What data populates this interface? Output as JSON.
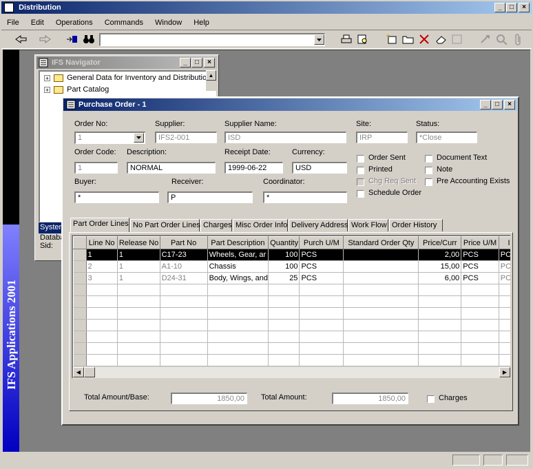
{
  "app": {
    "title": "Distribution",
    "menu": [
      "File",
      "Edit",
      "Operations",
      "Commands",
      "Window",
      "Help"
    ],
    "brand_text": "IFS Applications 2001",
    "window_buttons": {
      "minimize": "_",
      "maximize": "□",
      "close": "×"
    }
  },
  "navigator": {
    "title": "IFS Navigator",
    "items": [
      {
        "label": "General Data for Inventory and Distribution"
      },
      {
        "label": "Part Catalog"
      }
    ],
    "bottom": {
      "header": "Systen",
      "line1": "Databa",
      "line2": "Sid:"
    }
  },
  "po": {
    "title": "Purchase Order - 1",
    "labels": {
      "order_no": "Order No:",
      "supplier": "Supplier:",
      "supplier_name": "Supplier Name:",
      "site": "Site:",
      "status": "Status:",
      "order_code": "Order Code:",
      "description": "Description:",
      "receipt_date": "Receipt Date:",
      "currency": "Currency:",
      "buyer": "Buyer:",
      "receiver": "Receiver:",
      "coordinator": "Coordinator:"
    },
    "values": {
      "order_no": "1",
      "supplier": "IFS2-001",
      "supplier_name": "ISD",
      "site": "IRP",
      "status": "*Close",
      "order_code": "1",
      "description": "NORMAL",
      "receipt_date": "1999-06-22",
      "currency": "USD",
      "buyer": "*",
      "receiver": "P",
      "coordinator": "*"
    },
    "checkboxes": {
      "order_sent": "Order Sent",
      "printed": "Printed",
      "chg_req_sent": "Chg Req Sent",
      "schedule_order": "Schedule Order",
      "document_text": "Document Text",
      "note": "Note",
      "pre_accounting": "Pre Accounting Exists"
    },
    "tabs": [
      "Part Order Lines",
      "No Part Order Lines",
      "Charges",
      "Misc Order Info",
      "Delivery Address",
      "Work Flow",
      "Order History"
    ],
    "grid": {
      "columns": [
        "Line No",
        "Release No",
        "Part No",
        "Part Description",
        "Quantity",
        "Purch U/M",
        "Standard Order Qty",
        "Price/Curr",
        "Price U/M",
        "Inv"
      ],
      "rows": [
        [
          "1",
          "1",
          "C17-23",
          "Wheels, Gear, ar",
          "100",
          "PCS",
          "",
          "2,00",
          "PCS",
          "PCS"
        ],
        [
          "2",
          "1",
          "A1-10",
          "Chassis",
          "100",
          "PCS",
          "",
          "15,00",
          "PCS",
          "PCS"
        ],
        [
          "3",
          "1",
          "D24-31",
          "Body, Wings, and",
          "25",
          "PCS",
          "",
          "6,00",
          "PCS",
          "PCS"
        ]
      ]
    },
    "totals": {
      "base_label": "Total Amount/Base:",
      "base_value": "1850,00",
      "total_label": "Total Amount:",
      "total_value": "1850,00",
      "charges_label": "Charges"
    }
  }
}
